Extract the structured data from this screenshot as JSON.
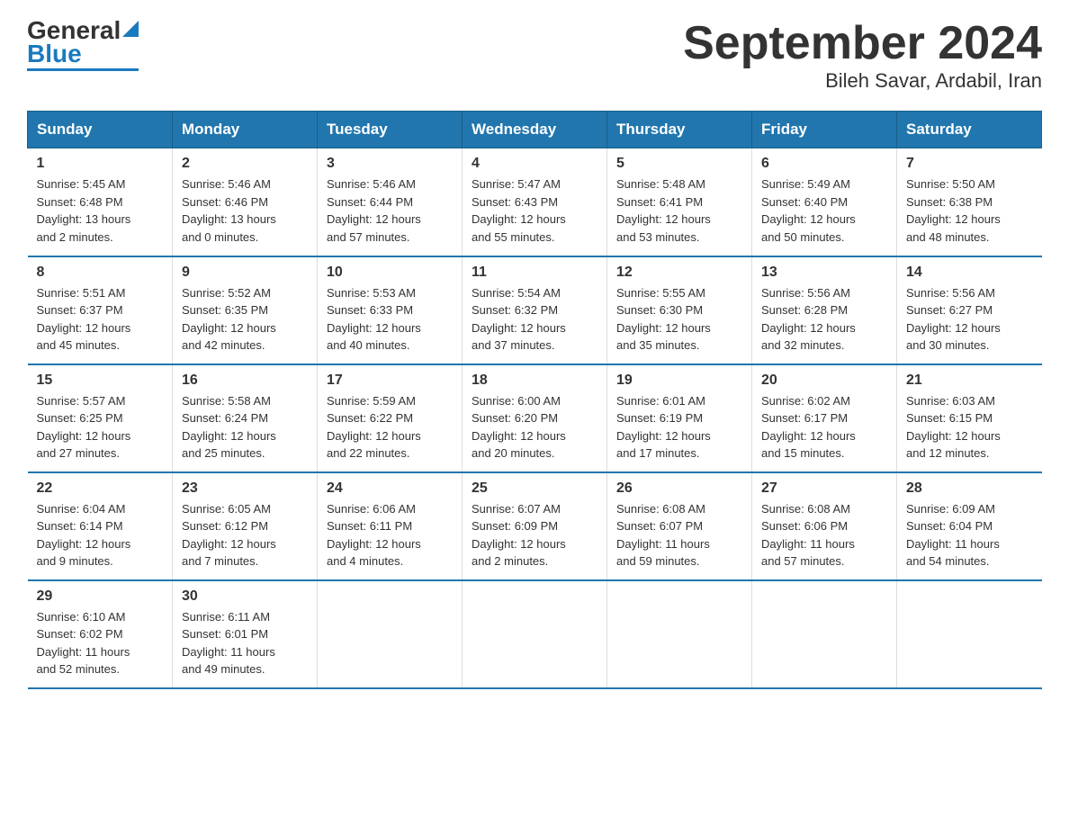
{
  "logo": {
    "text_general": "General",
    "text_blue": "Blue"
  },
  "title": "September 2024",
  "subtitle": "Bileh Savar, Ardabil, Iran",
  "weekdays": [
    "Sunday",
    "Monday",
    "Tuesday",
    "Wednesday",
    "Thursday",
    "Friday",
    "Saturday"
  ],
  "weeks": [
    [
      {
        "day": "1",
        "info": "Sunrise: 5:45 AM\nSunset: 6:48 PM\nDaylight: 13 hours\nand 2 minutes."
      },
      {
        "day": "2",
        "info": "Sunrise: 5:46 AM\nSunset: 6:46 PM\nDaylight: 13 hours\nand 0 minutes."
      },
      {
        "day": "3",
        "info": "Sunrise: 5:46 AM\nSunset: 6:44 PM\nDaylight: 12 hours\nand 57 minutes."
      },
      {
        "day": "4",
        "info": "Sunrise: 5:47 AM\nSunset: 6:43 PM\nDaylight: 12 hours\nand 55 minutes."
      },
      {
        "day": "5",
        "info": "Sunrise: 5:48 AM\nSunset: 6:41 PM\nDaylight: 12 hours\nand 53 minutes."
      },
      {
        "day": "6",
        "info": "Sunrise: 5:49 AM\nSunset: 6:40 PM\nDaylight: 12 hours\nand 50 minutes."
      },
      {
        "day": "7",
        "info": "Sunrise: 5:50 AM\nSunset: 6:38 PM\nDaylight: 12 hours\nand 48 minutes."
      }
    ],
    [
      {
        "day": "8",
        "info": "Sunrise: 5:51 AM\nSunset: 6:37 PM\nDaylight: 12 hours\nand 45 minutes."
      },
      {
        "day": "9",
        "info": "Sunrise: 5:52 AM\nSunset: 6:35 PM\nDaylight: 12 hours\nand 42 minutes."
      },
      {
        "day": "10",
        "info": "Sunrise: 5:53 AM\nSunset: 6:33 PM\nDaylight: 12 hours\nand 40 minutes."
      },
      {
        "day": "11",
        "info": "Sunrise: 5:54 AM\nSunset: 6:32 PM\nDaylight: 12 hours\nand 37 minutes."
      },
      {
        "day": "12",
        "info": "Sunrise: 5:55 AM\nSunset: 6:30 PM\nDaylight: 12 hours\nand 35 minutes."
      },
      {
        "day": "13",
        "info": "Sunrise: 5:56 AM\nSunset: 6:28 PM\nDaylight: 12 hours\nand 32 minutes."
      },
      {
        "day": "14",
        "info": "Sunrise: 5:56 AM\nSunset: 6:27 PM\nDaylight: 12 hours\nand 30 minutes."
      }
    ],
    [
      {
        "day": "15",
        "info": "Sunrise: 5:57 AM\nSunset: 6:25 PM\nDaylight: 12 hours\nand 27 minutes."
      },
      {
        "day": "16",
        "info": "Sunrise: 5:58 AM\nSunset: 6:24 PM\nDaylight: 12 hours\nand 25 minutes."
      },
      {
        "day": "17",
        "info": "Sunrise: 5:59 AM\nSunset: 6:22 PM\nDaylight: 12 hours\nand 22 minutes."
      },
      {
        "day": "18",
        "info": "Sunrise: 6:00 AM\nSunset: 6:20 PM\nDaylight: 12 hours\nand 20 minutes."
      },
      {
        "day": "19",
        "info": "Sunrise: 6:01 AM\nSunset: 6:19 PM\nDaylight: 12 hours\nand 17 minutes."
      },
      {
        "day": "20",
        "info": "Sunrise: 6:02 AM\nSunset: 6:17 PM\nDaylight: 12 hours\nand 15 minutes."
      },
      {
        "day": "21",
        "info": "Sunrise: 6:03 AM\nSunset: 6:15 PM\nDaylight: 12 hours\nand 12 minutes."
      }
    ],
    [
      {
        "day": "22",
        "info": "Sunrise: 6:04 AM\nSunset: 6:14 PM\nDaylight: 12 hours\nand 9 minutes."
      },
      {
        "day": "23",
        "info": "Sunrise: 6:05 AM\nSunset: 6:12 PM\nDaylight: 12 hours\nand 7 minutes."
      },
      {
        "day": "24",
        "info": "Sunrise: 6:06 AM\nSunset: 6:11 PM\nDaylight: 12 hours\nand 4 minutes."
      },
      {
        "day": "25",
        "info": "Sunrise: 6:07 AM\nSunset: 6:09 PM\nDaylight: 12 hours\nand 2 minutes."
      },
      {
        "day": "26",
        "info": "Sunrise: 6:08 AM\nSunset: 6:07 PM\nDaylight: 11 hours\nand 59 minutes."
      },
      {
        "day": "27",
        "info": "Sunrise: 6:08 AM\nSunset: 6:06 PM\nDaylight: 11 hours\nand 57 minutes."
      },
      {
        "day": "28",
        "info": "Sunrise: 6:09 AM\nSunset: 6:04 PM\nDaylight: 11 hours\nand 54 minutes."
      }
    ],
    [
      {
        "day": "29",
        "info": "Sunrise: 6:10 AM\nSunset: 6:02 PM\nDaylight: 11 hours\nand 52 minutes."
      },
      {
        "day": "30",
        "info": "Sunrise: 6:11 AM\nSunset: 6:01 PM\nDaylight: 11 hours\nand 49 minutes."
      },
      {
        "day": "",
        "info": ""
      },
      {
        "day": "",
        "info": ""
      },
      {
        "day": "",
        "info": ""
      },
      {
        "day": "",
        "info": ""
      },
      {
        "day": "",
        "info": ""
      }
    ]
  ]
}
